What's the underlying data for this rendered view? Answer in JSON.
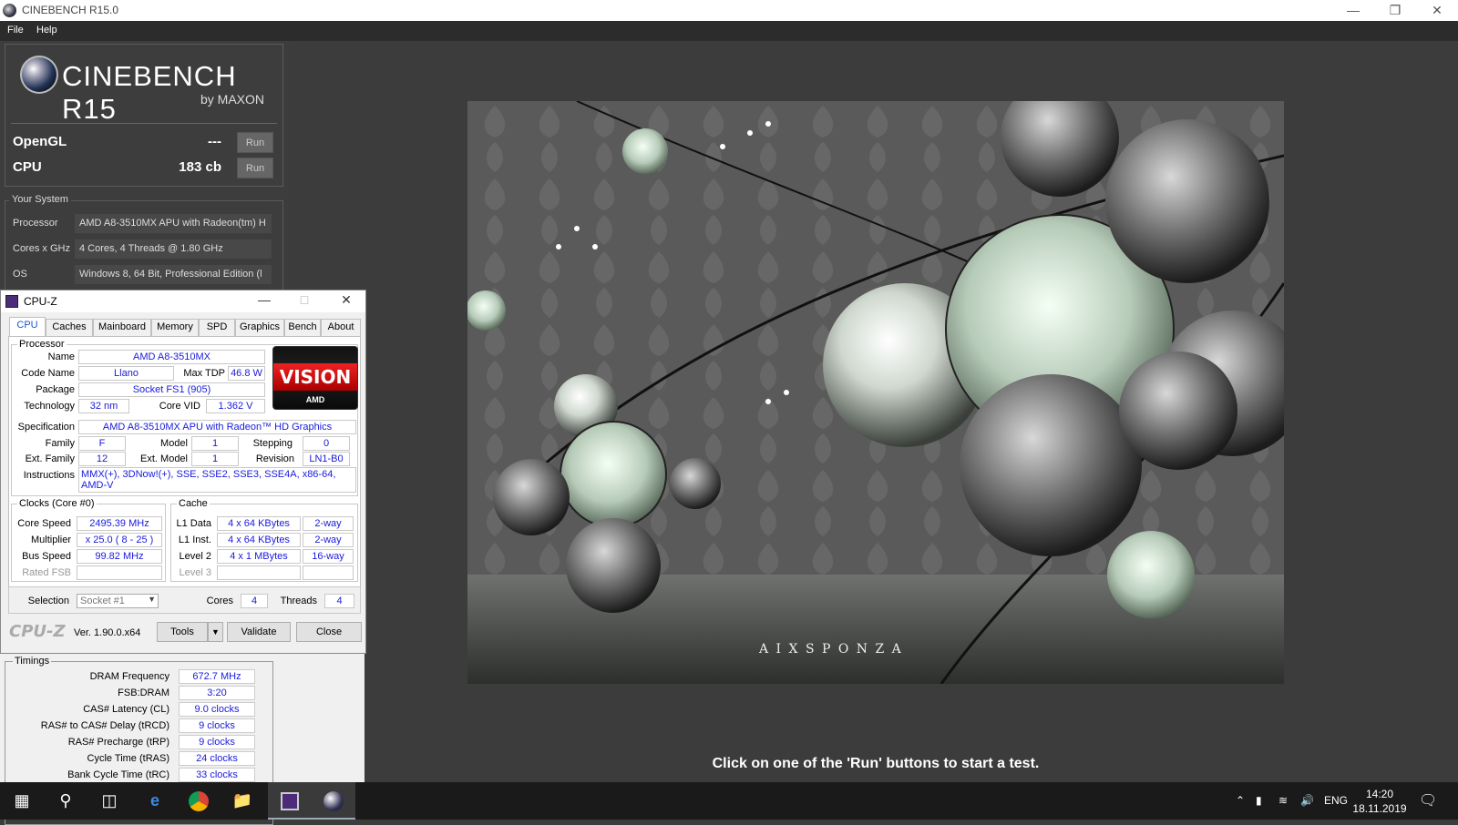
{
  "window": {
    "title": "CINEBENCH R15.0"
  },
  "menu": [
    "File",
    "Help"
  ],
  "logo": {
    "name": "CINEBENCH R15",
    "by": "by MAXON"
  },
  "scores": [
    {
      "label": "OpenGL",
      "value": "---",
      "run": "Run"
    },
    {
      "label": "CPU",
      "value": "183 cb",
      "run": "Run"
    }
  ],
  "system": {
    "legend": "Your System",
    "rows": [
      {
        "k": "Processor",
        "v": "AMD A8-3510MX APU with Radeon(tm) H"
      },
      {
        "k": "Cores x GHz",
        "v": "4 Cores, 4 Threads @ 1.80 GHz"
      },
      {
        "k": "OS",
        "v": "Windows 8, 64 Bit, Professional Edition (l"
      }
    ]
  },
  "status": "Click on one of the 'Run' buttons to start a test.",
  "render_watermark": "A I X S P O N Z A",
  "cpuz": {
    "title": "CPU-Z",
    "tabs": [
      "CPU",
      "Caches",
      "Mainboard",
      "Memory",
      "SPD",
      "Graphics",
      "Bench",
      "About"
    ],
    "processor": {
      "legend": "Processor",
      "name_l": "Name",
      "name": "AMD A8-3510MX",
      "codename_l": "Code Name",
      "codename": "Llano",
      "maxtdp_l": "Max TDP",
      "maxtdp": "46.8 W",
      "package_l": "Package",
      "package": "Socket FS1 (905)",
      "tech_l": "Technology",
      "tech": "32 nm",
      "corevid_l": "Core VID",
      "corevid": "1.362 V",
      "spec_l": "Specification",
      "spec": "AMD A8-3510MX APU with Radeon™ HD Graphics",
      "family_l": "Family",
      "family": "F",
      "model_l": "Model",
      "model": "1",
      "stepping_l": "Stepping",
      "stepping": "0",
      "extfamily_l": "Ext. Family",
      "extfamily": "12",
      "extmodel_l": "Ext. Model",
      "extmodel": "1",
      "revision_l": "Revision",
      "revision": "LN1-B0",
      "instr_l": "Instructions",
      "instr": "MMX(+), 3DNow!(+), SSE, SSE2, SSE3, SSE4A, x86-64, AMD-V",
      "logo_vision": "VISION",
      "logo_amd": "AMD"
    },
    "clocks": {
      "legend": "Clocks (Core #0)",
      "corespeed_l": "Core Speed",
      "corespeed": "2495.39 MHz",
      "multiplier_l": "Multiplier",
      "multiplier": "x 25.0 ( 8 - 25 )",
      "busspeed_l": "Bus Speed",
      "busspeed": "99.82 MHz",
      "ratedfsb_l": "Rated FSB",
      "ratedfsb": ""
    },
    "cache": {
      "legend": "Cache",
      "l1d_l": "L1 Data",
      "l1d": "4 x 64 KBytes",
      "l1d_w": "2-way",
      "l1i_l": "L1 Inst.",
      "l1i": "4 x 64 KBytes",
      "l1i_w": "2-way",
      "l2_l": "Level 2",
      "l2": "4 x 1 MBytes",
      "l2_w": "16-way",
      "l3_l": "Level 3",
      "l3": "",
      "l3_w": ""
    },
    "selection_l": "Selection",
    "selection": "Socket #1",
    "cores_l": "Cores",
    "cores": "4",
    "threads_l": "Threads",
    "threads": "4",
    "footer_logo": "CPU-Z",
    "version": "Ver. 1.90.0.x64",
    "tools": "Tools",
    "validate": "Validate",
    "close": "Close"
  },
  "timings": {
    "legend": "Timings",
    "rows": [
      {
        "k": "DRAM Frequency",
        "v": "672.7 MHz"
      },
      {
        "k": "FSB:DRAM",
        "v": "3:20"
      },
      {
        "k": "CAS# Latency (CL)",
        "v": "9.0 clocks"
      },
      {
        "k": "RAS# to CAS# Delay (tRCD)",
        "v": "9 clocks"
      },
      {
        "k": "RAS# Precharge (tRP)",
        "v": "9 clocks"
      },
      {
        "k": "Cycle Time (tRAS)",
        "v": "24 clocks"
      },
      {
        "k": "Bank Cycle Time (tRC)",
        "v": "33 clocks"
      }
    ]
  },
  "taskbar": {
    "lang": "ENG",
    "time": "14:20",
    "date": "18.11.2019"
  }
}
